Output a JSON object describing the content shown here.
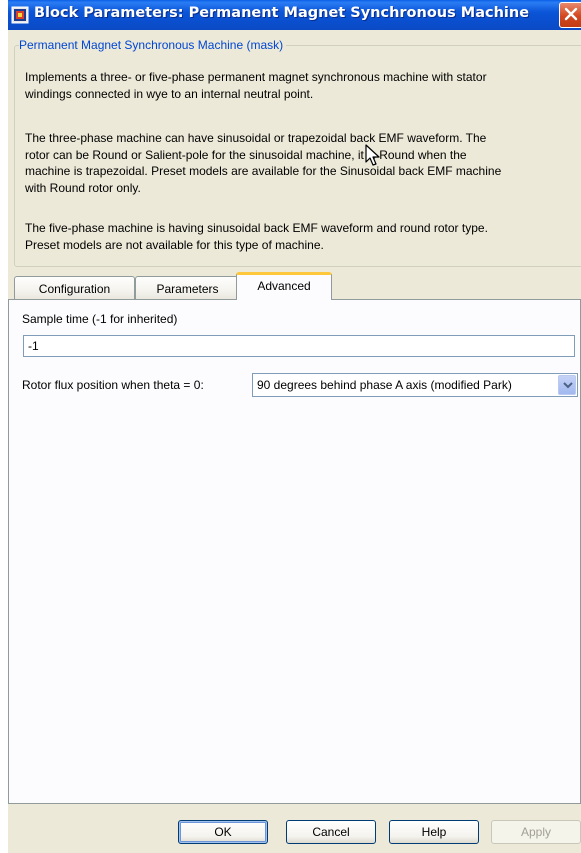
{
  "window": {
    "title": "Block Parameters: Permanent Magnet Synchronous Machine"
  },
  "mask": {
    "legend": "Permanent Magnet Synchronous Machine (mask)",
    "paragraphs": [
      [
        "Implements a three- or five-phase permanent magnet synchronous machine with stator",
        "windings connected in wye to an internal neutral point."
      ],
      [
        "The three-phase machine can have sinusoidal or trapezoidal back EMF waveform. The",
        "rotor can be Round or Salient-pole for the sinusoidal machine, it is Round when the",
        "machine is trapezoidal. Preset models are available for the Sinusoidal back EMF machine",
        "with Round rotor only."
      ],
      [
        "The five-phase machine is having sinusoidal back EMF waveform and round rotor type.",
        "Preset models are not available for this type of machine."
      ]
    ]
  },
  "tabs": [
    {
      "label": "Configuration",
      "active": false
    },
    {
      "label": "Parameters",
      "active": false
    },
    {
      "label": "Advanced",
      "active": true
    }
  ],
  "advanced": {
    "sample_time_label": "Sample time (-1 for inherited)",
    "sample_time_value": "-1",
    "rotor_flux_label": "Rotor flux position when theta = 0:",
    "rotor_flux_value": "90 degrees behind phase A axis (modified Park)"
  },
  "buttons": {
    "ok": "OK",
    "cancel": "Cancel",
    "help": "Help",
    "apply": "Apply"
  },
  "colors": {
    "titlebar": "#0a4fcf",
    "window_bg": "#ece9d8",
    "legend_text": "#0046d5",
    "active_tab_accent": "#ffc83c"
  },
  "icons": {
    "app": "simulink-block-icon",
    "close": "close-icon",
    "dropdown": "chevron-down-icon",
    "cursor": "mouse-cursor-icon"
  }
}
